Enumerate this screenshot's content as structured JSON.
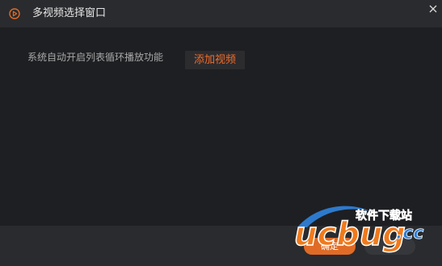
{
  "window": {
    "title": "多视频选择窗口",
    "title_icon": "play-circle-icon",
    "close_icon": "close-icon"
  },
  "content": {
    "description": "系统自动开启列表循环播放功能",
    "add_video_label": "添加视频"
  },
  "footer": {
    "confirm_label": "确定",
    "cancel_label": ""
  },
  "watermark": {
    "brand": "ucbug",
    "suffix": ".cc",
    "tagline": "软件下载站"
  },
  "colors": {
    "accent": "#e06b26",
    "background": "#1e1f22",
    "titlebar": "#2a2b2e",
    "text": "#e6e6e6",
    "muted_text": "#a8a8a8"
  }
}
